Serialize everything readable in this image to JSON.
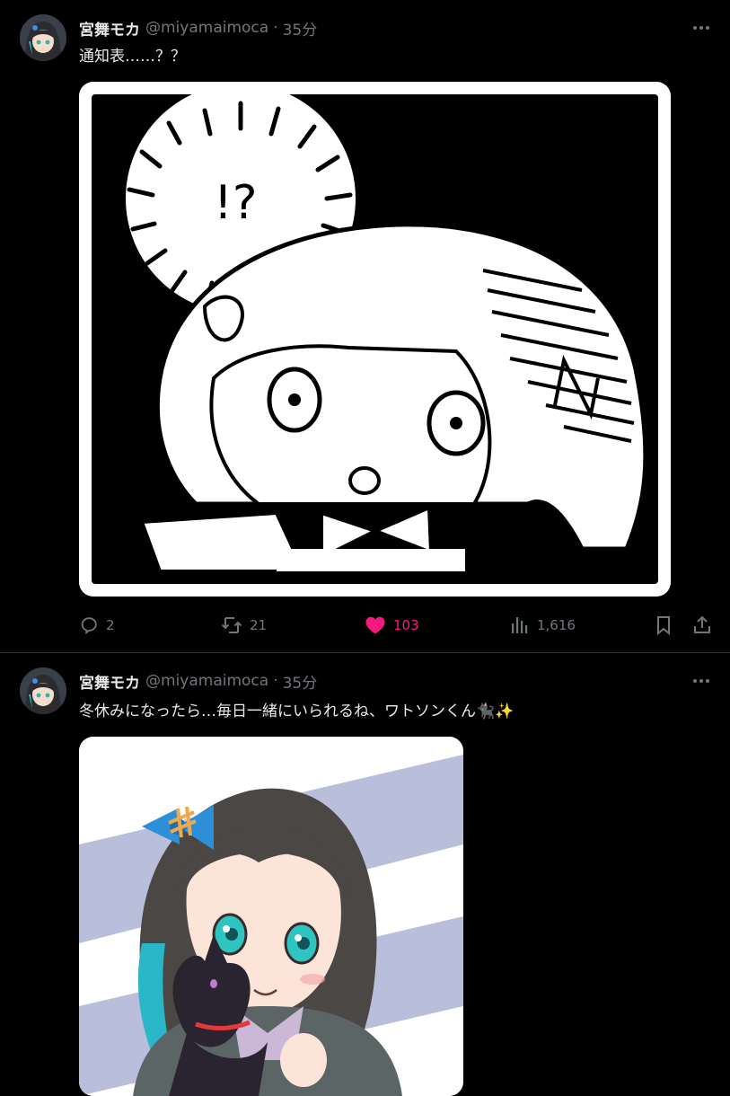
{
  "tweets": [
    {
      "author_name": "宮舞モカ",
      "author_handle": "@miyamaimoca",
      "separator": "·",
      "time": "35分",
      "text": "通知表……？？",
      "image": {
        "speech_text": "!?"
      },
      "actions": {
        "replies": "2",
        "retweets": "21",
        "likes": "103",
        "views": "1,616"
      },
      "like_color": "#f91880"
    },
    {
      "author_name": "宮舞モカ",
      "author_handle": "@miyamaimoca",
      "separator": "·",
      "time": "35分",
      "text": "冬休みになったら…毎日一緒にいられるね、ワトソンくん🐈‍⬛✨"
    }
  ],
  "colors": {
    "background": "#000000",
    "text_primary": "#e7e9ea",
    "text_secondary": "#71767b",
    "divider": "#2f3336"
  }
}
